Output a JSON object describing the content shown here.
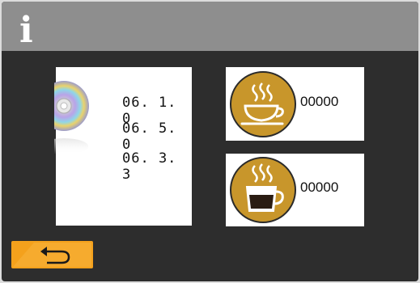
{
  "header": {
    "icon": "info-icon",
    "glyph": "i"
  },
  "versions": {
    "icon": "disc-icon",
    "items": [
      "06. 1. 0",
      "06. 5. 0",
      "06. 3. 3"
    ]
  },
  "counters": [
    {
      "icon": "coffee-cup-icon",
      "value": "00000"
    },
    {
      "icon": "espresso-cup-icon",
      "value": "00000"
    }
  ],
  "back_button": {
    "icon": "back-arrow-icon",
    "color": "#f4a11c"
  },
  "colors": {
    "header": "#8e8e8e",
    "background": "#2d2d2d",
    "cup_badge": "#c8962b"
  }
}
